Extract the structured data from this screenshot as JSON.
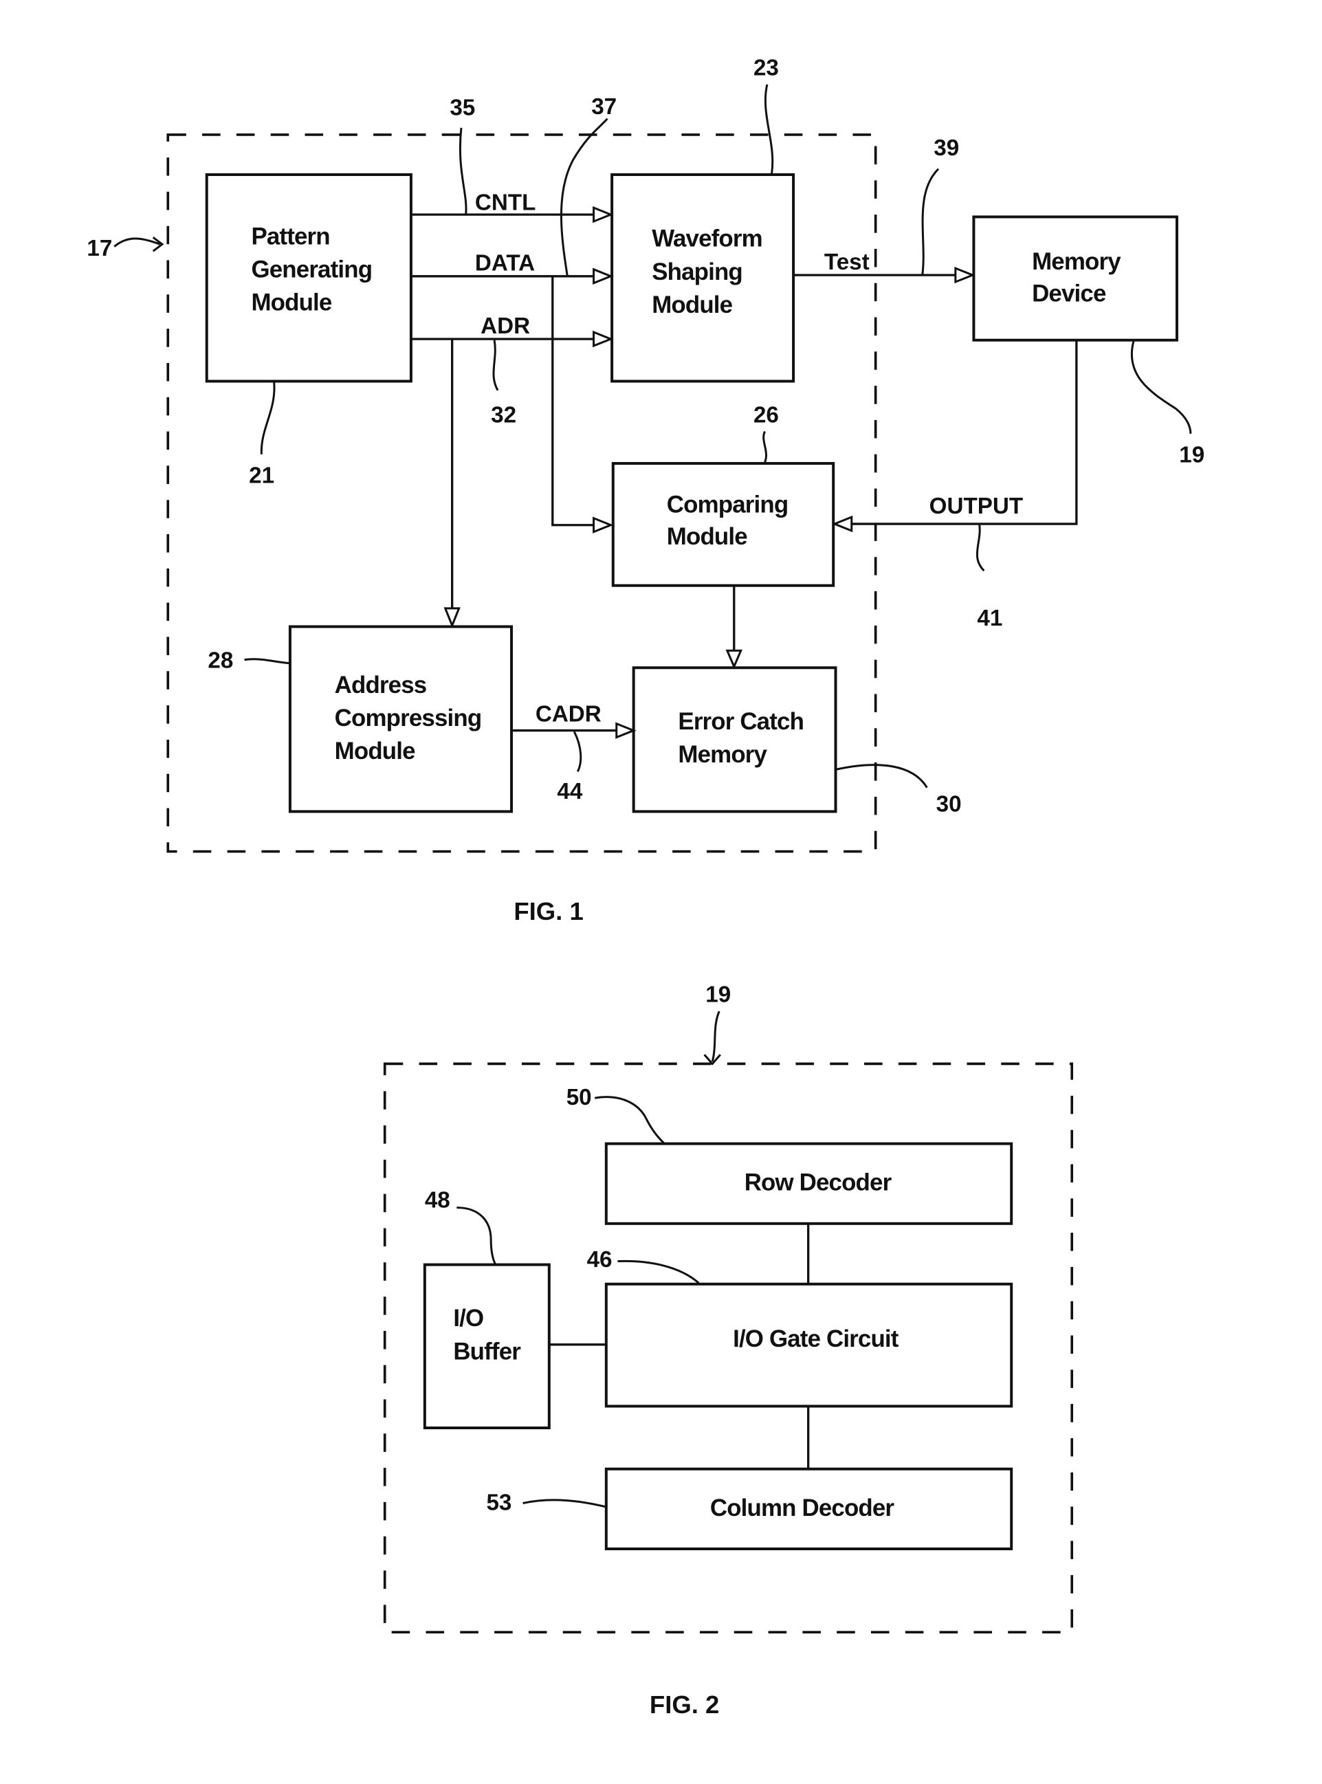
{
  "figures": [
    {
      "caption": "FIG. 1",
      "system_ref": "17",
      "modules": [
        {
          "id": "pattern",
          "ref": "21",
          "lines": [
            "Pattern",
            "Generating",
            "Module"
          ]
        },
        {
          "id": "waveform",
          "ref": "23",
          "lines": [
            "Waveform",
            "Shaping",
            "Module"
          ]
        },
        {
          "id": "comparing",
          "ref": "26",
          "lines": [
            "Comparing",
            "Module"
          ]
        },
        {
          "id": "address",
          "ref": "28",
          "lines": [
            "Address",
            "Compressing",
            "Module"
          ]
        },
        {
          "id": "errorcatch",
          "ref": "30",
          "lines": [
            "Error Catch",
            "Memory"
          ]
        },
        {
          "id": "memory",
          "ref": "19",
          "lines": [
            "Memory",
            "Device"
          ]
        }
      ],
      "signals": [
        {
          "label": "CNTL",
          "ref": "35"
        },
        {
          "label": "DATA",
          "ref": "37"
        },
        {
          "label": "ADR",
          "ref": "32"
        },
        {
          "label": "Test",
          "ref": "39"
        },
        {
          "label": "OUTPUT",
          "ref": "41"
        },
        {
          "label": "CADR",
          "ref": "44"
        }
      ]
    },
    {
      "caption": "FIG. 2",
      "system_ref": "19",
      "modules": [
        {
          "id": "row",
          "ref": "50",
          "lines": [
            "Row Decoder"
          ]
        },
        {
          "id": "iogate",
          "ref": "46",
          "lines": [
            "I/O Gate Circuit"
          ]
        },
        {
          "id": "iobuffer",
          "ref": "48",
          "lines": [
            "I/O",
            "Buffer"
          ]
        },
        {
          "id": "column",
          "ref": "53",
          "lines": [
            "Column Decoder"
          ]
        }
      ]
    }
  ]
}
